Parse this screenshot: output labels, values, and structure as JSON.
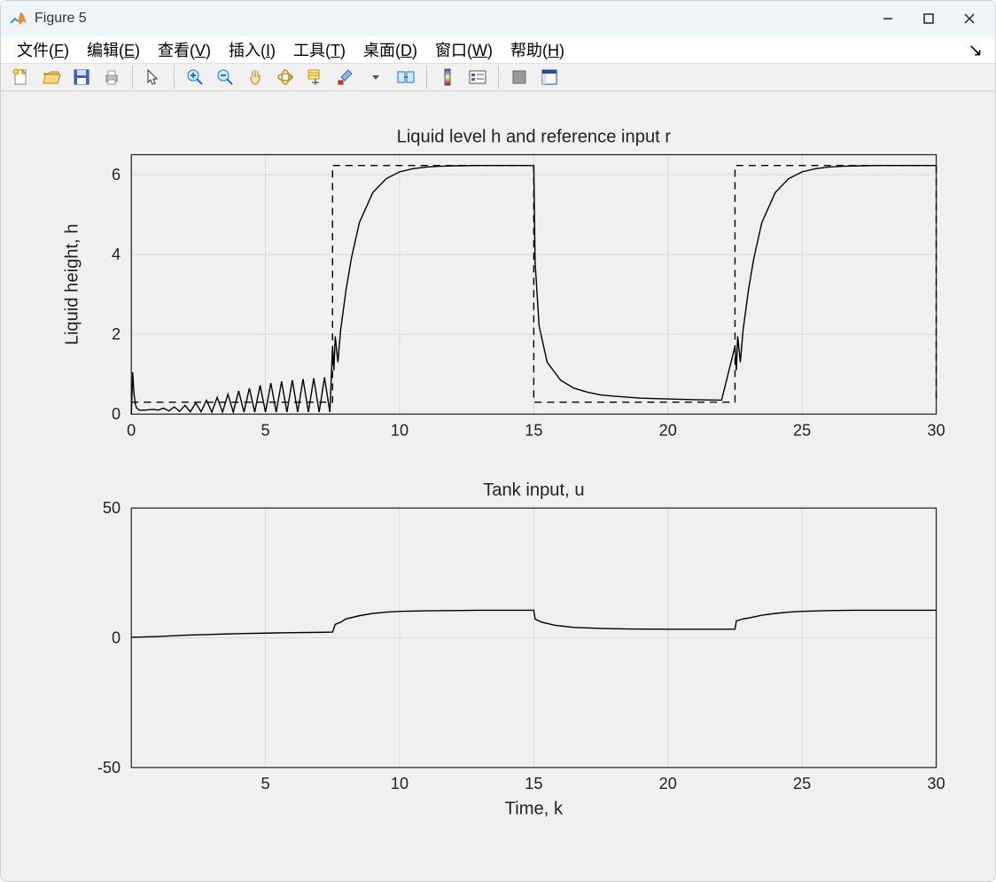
{
  "window": {
    "title": "Figure 5"
  },
  "menu": {
    "file": "文件(F)",
    "edit": "编辑(E)",
    "view": "查看(V)",
    "insert": "插入(I)",
    "tools": "工具(T)",
    "desktop": "桌面(D)",
    "window": "窗口(W)",
    "help": "帮助(H)"
  },
  "toolbar": {
    "new": "new-figure",
    "open": "open",
    "save": "save",
    "print": "print",
    "pointer": "pointer",
    "zoomin": "zoom-in",
    "zoomout": "zoom-out",
    "pan": "pan",
    "rotate": "rotate-3d",
    "datacursor": "data-cursor",
    "brush": "brush",
    "link": "link-plots",
    "colorbar": "colorbar",
    "legend": "legend",
    "hide": "hide-plot-tools",
    "show": "show-plot-tools"
  },
  "chart_data": [
    {
      "type": "line",
      "title": "Liquid level h and reference input r",
      "xlabel": "",
      "ylabel": "Liquid height, h",
      "xlim": [
        0,
        30
      ],
      "ylim": [
        0,
        6.5
      ],
      "xticks": [
        0,
        5,
        10,
        15,
        20,
        25,
        30
      ],
      "yticks": [
        0,
        2,
        4,
        6
      ],
      "grid": true,
      "series": [
        {
          "name": "h",
          "style": "solid",
          "x": [
            0,
            0.05,
            0.1,
            0.15,
            0.2,
            0.3,
            0.5,
            0.8,
            1.0,
            1.2,
            1.4,
            1.6,
            1.8,
            2.0,
            2.2,
            2.4,
            2.6,
            2.8,
            3.0,
            3.2,
            3.4,
            3.6,
            3.8,
            4.0,
            4.2,
            4.4,
            4.6,
            4.8,
            5.0,
            5.2,
            5.4,
            5.6,
            5.8,
            6.0,
            6.2,
            6.4,
            6.6,
            6.8,
            7.0,
            7.2,
            7.4,
            7.5,
            7.55,
            7.6,
            7.7,
            7.8,
            7.9,
            8.0,
            8.2,
            8.5,
            9.0,
            9.5,
            10.0,
            10.5,
            11.0,
            11.5,
            12.0,
            13.0,
            14.0,
            15.0,
            15.05,
            15.2,
            15.5,
            16.0,
            16.5,
            17.0,
            17.5,
            18.0,
            19.0,
            20.0,
            21.0,
            22.0,
            22.5,
            22.55,
            22.6,
            22.7,
            22.8,
            22.9,
            23.0,
            23.2,
            23.5,
            24.0,
            24.5,
            25.0,
            25.5,
            26.0,
            26.5,
            27.0,
            28.0,
            29.0,
            30.0
          ],
          "y": [
            0,
            1.05,
            0.5,
            0.25,
            0.15,
            0.1,
            0.1,
            0.12,
            0.1,
            0.15,
            0.08,
            0.18,
            0.07,
            0.22,
            0.06,
            0.28,
            0.06,
            0.35,
            0.05,
            0.42,
            0.05,
            0.5,
            0.05,
            0.58,
            0.05,
            0.65,
            0.05,
            0.72,
            0.05,
            0.78,
            0.05,
            0.82,
            0.05,
            0.85,
            0.05,
            0.88,
            0.05,
            0.9,
            0.05,
            0.92,
            0.05,
            1.7,
            1.1,
            1.95,
            1.3,
            2.1,
            2.6,
            3.1,
            3.9,
            4.8,
            5.55,
            5.9,
            6.07,
            6.15,
            6.19,
            6.21,
            6.22,
            6.23,
            6.23,
            6.23,
            3.8,
            2.2,
            1.3,
            0.85,
            0.65,
            0.55,
            0.48,
            0.45,
            0.4,
            0.38,
            0.36,
            0.35,
            1.7,
            1.1,
            1.95,
            1.3,
            2.1,
            2.6,
            3.1,
            3.9,
            4.8,
            5.55,
            5.9,
            6.07,
            6.15,
            6.19,
            6.21,
            6.22,
            6.23,
            6.23,
            6.23
          ]
        },
        {
          "name": "r",
          "style": "dashed",
          "x": [
            0,
            7.5,
            7.5,
            15,
            15,
            22.5,
            22.5,
            30,
            30
          ],
          "y": [
            0.3,
            0.3,
            6.23,
            6.23,
            0.3,
            0.3,
            6.23,
            6.23,
            0.3
          ]
        }
      ]
    },
    {
      "type": "line",
      "title": "Tank input, u",
      "xlabel": "Time, k",
      "ylabel": "",
      "xlim": [
        0,
        30
      ],
      "ylim": [
        -50,
        50
      ],
      "xticks": [
        5,
        10,
        15,
        20,
        25,
        30
      ],
      "yticks": [
        -50,
        0,
        50
      ],
      "grid": true,
      "series": [
        {
          "name": "u",
          "style": "solid",
          "x": [
            0,
            1,
            2,
            3,
            4,
            5,
            6,
            7,
            7.5,
            7.6,
            7.8,
            8.0,
            8.5,
            9.0,
            9.5,
            10.0,
            11,
            12,
            13,
            14,
            15,
            15.05,
            15.3,
            15.8,
            16.5,
            17.5,
            18.5,
            20,
            21,
            22,
            22.5,
            22.55,
            22.8,
            23.0,
            23.5,
            24.0,
            24.5,
            25,
            26,
            27,
            28,
            29,
            30
          ],
          "y": [
            0.2,
            0.5,
            1.0,
            1.3,
            1.6,
            1.8,
            2.0,
            2.1,
            2.2,
            5.2,
            6.0,
            7.3,
            8.5,
            9.4,
            9.9,
            10.2,
            10.4,
            10.5,
            10.6,
            10.6,
            10.6,
            7.2,
            6.0,
            4.8,
            4.0,
            3.6,
            3.4,
            3.3,
            3.3,
            3.3,
            3.3,
            6.5,
            7.3,
            7.6,
            8.7,
            9.4,
            9.9,
            10.2,
            10.5,
            10.6,
            10.6,
            10.6,
            10.6
          ]
        }
      ]
    }
  ]
}
